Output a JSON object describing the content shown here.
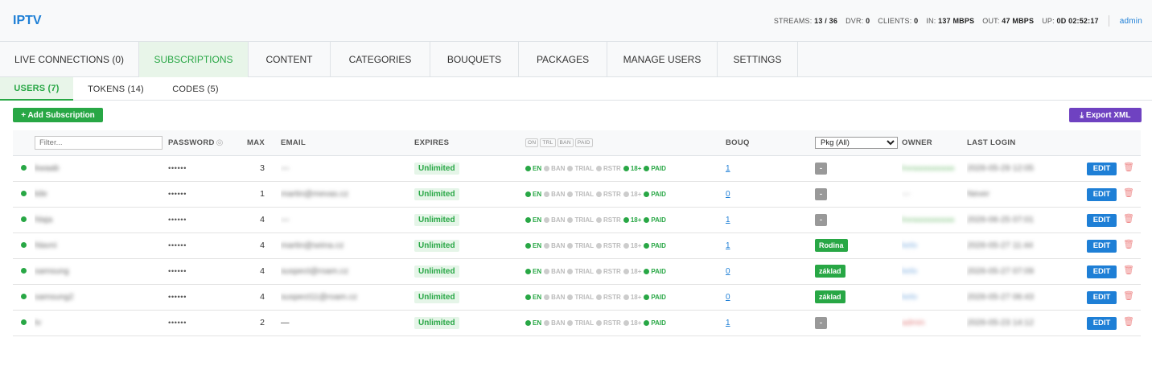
{
  "app": {
    "title": "IPTV"
  },
  "stats": [
    {
      "label": "STREAMS:",
      "value": "13 / 36"
    },
    {
      "label": "DVR:",
      "value": "0"
    },
    {
      "label": "CLIENTS:",
      "value": "0"
    },
    {
      "label": "IN:",
      "value": "137 MBPS"
    },
    {
      "label": "OUT:",
      "value": "47 MBPS"
    },
    {
      "label": "UP:",
      "value": "0D 02:52:17"
    }
  ],
  "user": {
    "name": "admin"
  },
  "main_tabs": [
    {
      "label": "LIVE CONNECTIONS (0)",
      "active": false
    },
    {
      "label": "SUBSCRIPTIONS",
      "active": true
    },
    {
      "label": "CONTENT",
      "active": false
    },
    {
      "label": "CATEGORIES",
      "active": false
    },
    {
      "label": "BOUQUETS",
      "active": false
    },
    {
      "label": "PACKAGES",
      "active": false
    },
    {
      "label": "MANAGE USERS",
      "active": false
    },
    {
      "label": "SETTINGS",
      "active": false
    }
  ],
  "sub_tabs": [
    {
      "label": "USERS (7)",
      "active": true
    },
    {
      "label": "TOKENS (14)",
      "active": false
    },
    {
      "label": "CODES (5)",
      "active": false
    }
  ],
  "toolbar": {
    "add_label": "+ Add Subscription",
    "export_label": "Export XML"
  },
  "table": {
    "filter_placeholder": "Filter...",
    "headers": {
      "password": "PASSWORD",
      "max": "MAX",
      "email": "EMAIL",
      "expires": "EXPIRES",
      "flags": [
        "ON",
        "TRL",
        "BAN",
        "PAID"
      ],
      "bouq": "BOUQ",
      "pkg_select": "Pkg (All)",
      "owner": "OWNER",
      "last_login": "LAST LOGIN"
    },
    "flag_labels": [
      "EN",
      "BAN",
      "TRIAL",
      "RSTR",
      "18+",
      "PAID"
    ],
    "edit_label": "EDIT",
    "rows": [
      {
        "username": "kwaab",
        "password": "••••••",
        "max": "3",
        "email": "—",
        "email_blur": true,
        "expires": "Unlimited",
        "flags": [
          true,
          false,
          false,
          false,
          true,
          true
        ],
        "bouq": "1",
        "pkg": "-",
        "pkg_type": "empty",
        "owner": "kwaaaaaaaaa",
        "owner_color": "g",
        "last_login": "2026-05-29 12:05"
      },
      {
        "username": "kile",
        "password": "••••••",
        "max": "1",
        "email": "martin@mevas.cz",
        "email_blur": true,
        "expires": "Unlimited",
        "flags": [
          true,
          false,
          false,
          false,
          false,
          true
        ],
        "bouq": "0",
        "pkg": "-",
        "pkg_type": "empty",
        "owner": "—",
        "owner_color": "n",
        "last_login": "Never"
      },
      {
        "username": "hlaja",
        "password": "••••••",
        "max": "4",
        "email": "—",
        "email_blur": true,
        "expires": "Unlimited",
        "flags": [
          true,
          false,
          false,
          false,
          true,
          true
        ],
        "bouq": "1",
        "pkg": "-",
        "pkg_type": "empty",
        "owner": "kwaaaaaaaaa",
        "owner_color": "g",
        "last_login": "2026-06-25 07:01"
      },
      {
        "username": "hlavni",
        "password": "••••••",
        "max": "4",
        "email": "martin@seina.cz",
        "email_blur": true,
        "expires": "Unlimited",
        "flags": [
          true,
          false,
          false,
          false,
          false,
          true
        ],
        "bouq": "1",
        "pkg": "Rodina",
        "pkg_type": "badge",
        "owner": "kelo",
        "owner_color": "b",
        "last_login": "2026-05-27 11:44"
      },
      {
        "username": "samsung",
        "password": "••••••",
        "max": "4",
        "email": "suspect@roam.cz",
        "email_blur": true,
        "expires": "Unlimited",
        "flags": [
          true,
          false,
          false,
          false,
          false,
          true
        ],
        "bouq": "0",
        "pkg": "základ",
        "pkg_type": "badge",
        "owner": "kelo",
        "owner_color": "b",
        "last_login": "2026-05-27 07:09"
      },
      {
        "username": "samsung2",
        "password": "••••••",
        "max": "4",
        "email": "suspect11@roam.cz",
        "email_blur": true,
        "expires": "Unlimited",
        "flags": [
          true,
          false,
          false,
          false,
          false,
          true
        ],
        "bouq": "0",
        "pkg": "základ",
        "pkg_type": "badge",
        "owner": "kelo",
        "owner_color": "b",
        "last_login": "2026-05-27 06:43"
      },
      {
        "username": "tv",
        "password": "••••••",
        "max": "2",
        "email": "—",
        "email_blur": false,
        "expires": "Unlimited",
        "flags": [
          true,
          false,
          false,
          false,
          false,
          true
        ],
        "bouq": "1",
        "pkg": "-",
        "pkg_type": "empty",
        "owner": "admin",
        "owner_color": "r",
        "last_login": "2026-05-23 14:12"
      }
    ]
  }
}
